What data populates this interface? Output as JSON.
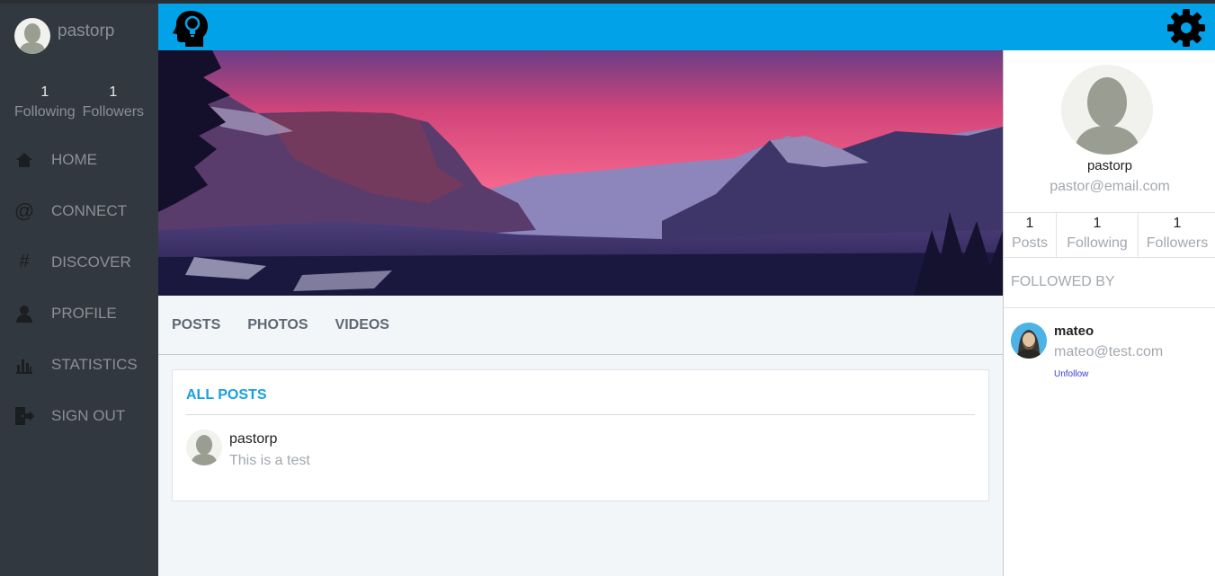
{
  "sidebar": {
    "username": "pastorp",
    "stats": [
      {
        "value": "1",
        "label": "Following"
      },
      {
        "value": "1",
        "label": "Followers"
      }
    ],
    "nav": [
      {
        "label": "HOME",
        "icon": "home-icon"
      },
      {
        "label": "CONNECT",
        "icon": "at-icon"
      },
      {
        "label": "DISCOVER",
        "icon": "hashtag-icon"
      },
      {
        "label": "PROFILE",
        "icon": "user-icon"
      },
      {
        "label": "STATISTICS",
        "icon": "bar-chart-icon"
      },
      {
        "label": "SIGN OUT",
        "icon": "sign-out-icon"
      }
    ]
  },
  "header": {
    "logo_icon": "head-lightbulb-icon",
    "settings_icon": "gear-icon",
    "color": "#02a2e9"
  },
  "tabs": [
    "POSTS",
    "PHOTOS",
    "VIDEOS"
  ],
  "posts": {
    "title": "ALL POSTS",
    "items": [
      {
        "author": "pastorp",
        "text": "This is a test"
      }
    ]
  },
  "profile": {
    "name": "pastorp",
    "email": "pastor@email.com",
    "stats": [
      {
        "value": "1",
        "label": "Posts"
      },
      {
        "value": "1",
        "label": "Following"
      },
      {
        "value": "1",
        "label": "Followers"
      }
    ],
    "followed_by_title": "FOLLOWED BY",
    "followers": [
      {
        "name": "mateo",
        "email": "mateo@test.com",
        "action": "Unfollow"
      }
    ]
  }
}
